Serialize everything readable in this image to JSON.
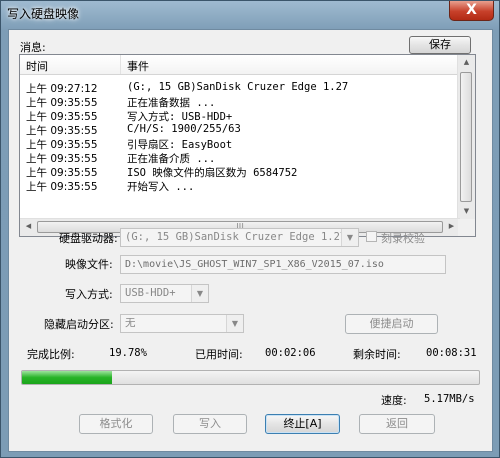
{
  "window": {
    "title": "写入硬盘映像",
    "close_label": "X"
  },
  "log": {
    "label": "消息:",
    "save_label": "保存",
    "columns": [
      "时间",
      "事件"
    ],
    "rows": [
      {
        "time": "上午 09:27:12",
        "event": "(G:, 15 GB)SanDisk Cruzer Edge      1.27"
      },
      {
        "time": "上午 09:35:55",
        "event": "正在准备数据 ..."
      },
      {
        "time": "上午 09:35:55",
        "event": "写入方式: USB-HDD+"
      },
      {
        "time": "上午 09:35:55",
        "event": "C/H/S: 1900/255/63"
      },
      {
        "time": "上午 09:35:55",
        "event": "引导扇区: EasyBoot"
      },
      {
        "time": "上午 09:35:55",
        "event": "正在准备介质 ..."
      },
      {
        "time": "上午 09:35:55",
        "event": "ISO 映像文件的扇区数为 6584752"
      },
      {
        "time": "上午 09:35:55",
        "event": "开始写入 ..."
      }
    ]
  },
  "form": {
    "drive_label": "硬盘驱动器:",
    "drive_value": "(G:, 15 GB)SanDisk Cruzer Edge      1.27",
    "verify_label": "刻录校验",
    "image_label": "映像文件:",
    "image_value": "D:\\movie\\JS_GHOST_WIN7_SP1_X86_V2015_07.iso",
    "mode_label": "写入方式:",
    "mode_value": "USB-HDD+",
    "hidden_label": "隐藏启动分区:",
    "hidden_value": "无",
    "quick_boot_label": "便捷启动"
  },
  "status": {
    "ratio_label": "完成比例:",
    "ratio_value": "19.78%",
    "elapsed_label": "已用时间:",
    "elapsed_value": "00:02:06",
    "remaining_label": "剩余时间:",
    "remaining_value": "00:08:31",
    "progress_percent": 19.78,
    "speed_label": "速度:",
    "speed_value": "5.17MB/s"
  },
  "buttons": {
    "format": "格式化",
    "write": "写入",
    "stop": "终止[A]",
    "back": "返回"
  },
  "icons": {
    "up": "▲",
    "down": "▼",
    "left": "◀",
    "right": "▶",
    "grip": "|||",
    "dropdown": "▼"
  }
}
